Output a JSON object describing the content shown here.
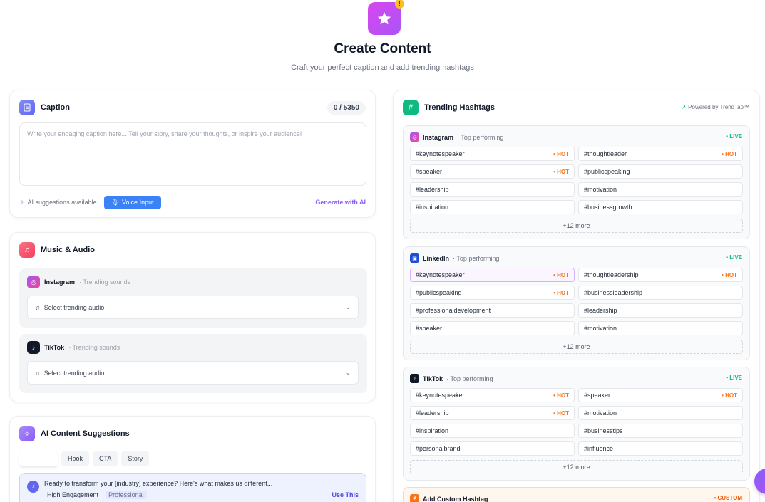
{
  "header": {
    "badge": "!",
    "title": "Create Content",
    "subtitle": "Craft your perfect caption and add trending hashtags"
  },
  "caption": {
    "title": "Caption",
    "counter": "0 / 5350",
    "placeholder": "Write your engaging caption here... Tell your story, share your thoughts, or inspire your audience!",
    "ai_available": "AI suggestions available",
    "voice_input": "Voice Input",
    "generate": "Generate with AI"
  },
  "music": {
    "title": "Music & Audio",
    "platforms": [
      {
        "name": "Instagram",
        "tag": "· Trending sounds",
        "select": "Select trending audio"
      },
      {
        "name": "TikTok",
        "tag": "· Trending sounds",
        "select": "Select trending audio"
      }
    ]
  },
  "ai_content": {
    "title": "AI Content Suggestions",
    "tabs": [
      "",
      "Hook",
      "CTA",
      "Story"
    ],
    "suggestion": {
      "text": "Ready to transform your [industry] experience? Here's what makes us different...",
      "tag1": "High Engagement",
      "tag2": "Professional",
      "use": "Use This"
    }
  },
  "trending": {
    "title": "Trending Hashtags",
    "powered": "Powered by TrendTap™",
    "platforms": [
      {
        "name": "Instagram",
        "sub": "· Top performing",
        "live": "LIVE",
        "more": "+12 more",
        "tags": [
          {
            "t": "#keynotespeaker",
            "hot": "HOT"
          },
          {
            "t": "#thoughtleader",
            "hot": "HOT"
          },
          {
            "t": "#speaker",
            "hot": "HOT"
          },
          {
            "t": "#publicspeaking",
            "hot": ""
          },
          {
            "t": "#leadership",
            "hot": ""
          },
          {
            "t": "#motivation",
            "hot": ""
          },
          {
            "t": "#inspiration",
            "hot": ""
          },
          {
            "t": "#businessgrowth",
            "hot": ""
          }
        ]
      },
      {
        "name": "LinkedIn",
        "sub": "· Top performing",
        "live": "LIVE",
        "more": "+12 more",
        "tags": [
          {
            "t": "#keynotespeaker",
            "hot": "HOT"
          },
          {
            "t": "#thoughtleadership",
            "hot": "HOT"
          },
          {
            "t": "#publicspeaking",
            "hot": "HOT"
          },
          {
            "t": "#businessleadership",
            "hot": ""
          },
          {
            "t": "#professionaldevelopment",
            "hot": ""
          },
          {
            "t": "#leadership",
            "hot": ""
          },
          {
            "t": "#speaker",
            "hot": ""
          },
          {
            "t": "#motivation",
            "hot": ""
          }
        ]
      },
      {
        "name": "TikTok",
        "sub": "· Top performing",
        "live": "LIVE",
        "more": "+12 more",
        "tags": [
          {
            "t": "#keynotespeaker",
            "hot": "HOT"
          },
          {
            "t": "#speaker",
            "hot": "HOT"
          },
          {
            "t": "#leadership",
            "hot": "HOT"
          },
          {
            "t": "#motivation",
            "hot": ""
          },
          {
            "t": "#inspiration",
            "hot": ""
          },
          {
            "t": "#businesstips",
            "hot": ""
          },
          {
            "t": "#personalbrand",
            "hot": ""
          },
          {
            "t": "#influence",
            "hot": ""
          }
        ]
      }
    ],
    "custom": {
      "title": "Add Custom Hashtag",
      "badge": "CUSTOM"
    }
  }
}
